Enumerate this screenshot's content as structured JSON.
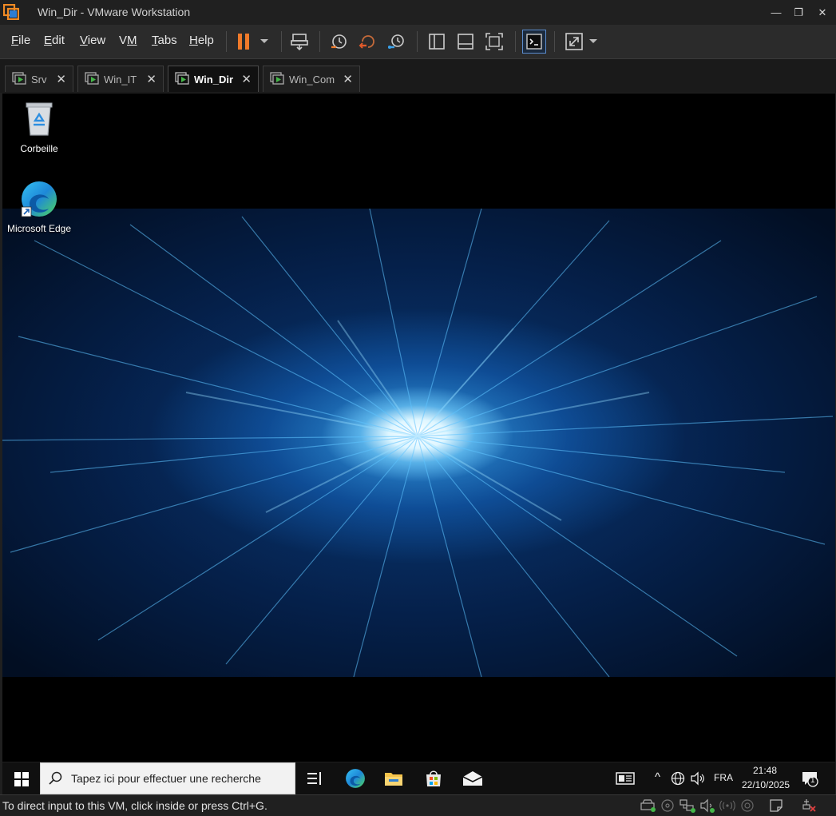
{
  "window": {
    "title": "Win_Dir - VMware Workstation",
    "controls": {
      "minimize": "—",
      "restore": "❐",
      "close": "✕"
    }
  },
  "menu": {
    "file": {
      "u": "F",
      "rest": "ile"
    },
    "edit": {
      "u": "E",
      "rest": "dit"
    },
    "view": {
      "u": "V",
      "rest": "iew"
    },
    "vm": {
      "pre": "V",
      "u": "M",
      "rest": ""
    },
    "tabs": {
      "u": "T",
      "rest": "abs"
    },
    "help": {
      "u": "H",
      "rest": "elp"
    }
  },
  "toolbar": {
    "icons": [
      "pause-icon",
      "dropdown-arrow-icon",
      "send-ctrl-alt-del-icon",
      "snapshot-icon",
      "revert-snapshot-icon",
      "snapshot-manager-icon",
      "library-view-icon",
      "thumbnail-bar-icon",
      "full-screen-icon",
      "console-view-icon",
      "stretch-guest-icon",
      "stretch-dropdown-icon"
    ],
    "accent": "#f07a2a"
  },
  "tabs": [
    {
      "label": "Srv",
      "active": false
    },
    {
      "label": "Win_IT",
      "active": false
    },
    {
      "label": "Win_Dir",
      "active": true
    },
    {
      "label": "Win_Com",
      "active": false
    }
  ],
  "tab_close": "✕",
  "desktop": {
    "icons": [
      {
        "label": "Corbeille",
        "icon": "recycle-bin-icon"
      },
      {
        "label": "Microsoft Edge",
        "icon": "edge-icon"
      }
    ]
  },
  "taskbar": {
    "search_placeholder": "Tapez ici pour effectuer une recherche",
    "apps": [
      "task-view-icon",
      "edge-icon",
      "file-explorer-icon",
      "store-icon",
      "mail-icon"
    ],
    "tray": {
      "chevron": "^",
      "language": "FRA",
      "time": "21:48",
      "date": "22/10/2025",
      "notifications": "1"
    }
  },
  "status": {
    "message": "To direct input to this VM, click inside or press Ctrl+G."
  },
  "colors": {
    "vm_green": "#45b649",
    "highlight_blue": "#5a8ccf"
  }
}
